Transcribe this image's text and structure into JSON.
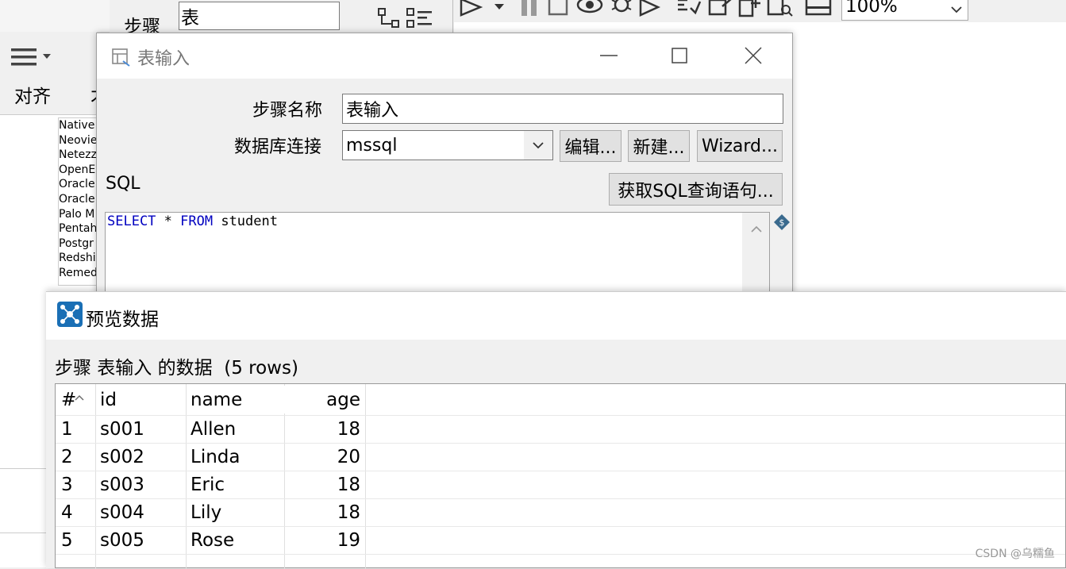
{
  "background": {
    "step_label": "步骤",
    "step_value": "表",
    "zoom": "100%",
    "align_label": "对齐",
    "partial_label": "才",
    "db_list": [
      "Native",
      "Neovie",
      "Netezz",
      "OpenE",
      "Oracle",
      "Oracle",
      "Palo M",
      "Pentah",
      "Postgr",
      "Redshi",
      "Remed"
    ]
  },
  "dialog": {
    "title": "表输入",
    "step_name_label": "步骤名称",
    "step_name_value": "表输入",
    "db_conn_label": "数据库连接",
    "db_conn_value": "mssql",
    "edit_button": "编辑...",
    "new_button": "新建...",
    "wizard_button": "Wizard...",
    "sql_label": "SQL",
    "get_sql_button": "获取SQL查询语句...",
    "sql_keyword_select": "SELECT",
    "sql_star": " * ",
    "sql_keyword_from": "FROM",
    "sql_table": " student"
  },
  "preview": {
    "title": "预览数据",
    "subtitle": "步骤 表输入 的数据  (5 rows)",
    "columns": [
      "#",
      "id",
      "name",
      "age"
    ],
    "rows": [
      [
        "1",
        "s001",
        "Allen",
        "18"
      ],
      [
        "2",
        "s002",
        "Linda",
        "20"
      ],
      [
        "3",
        "s003",
        "Eric",
        "18"
      ],
      [
        "4",
        "s004",
        "Lily",
        "18"
      ],
      [
        "5",
        "s005",
        "Rose",
        "19"
      ]
    ]
  },
  "watermark": "CSDN @乌糯鱼",
  "colors": {
    "sql_keyword": "#0000c0",
    "preview_icon": "#1a6fb5"
  }
}
